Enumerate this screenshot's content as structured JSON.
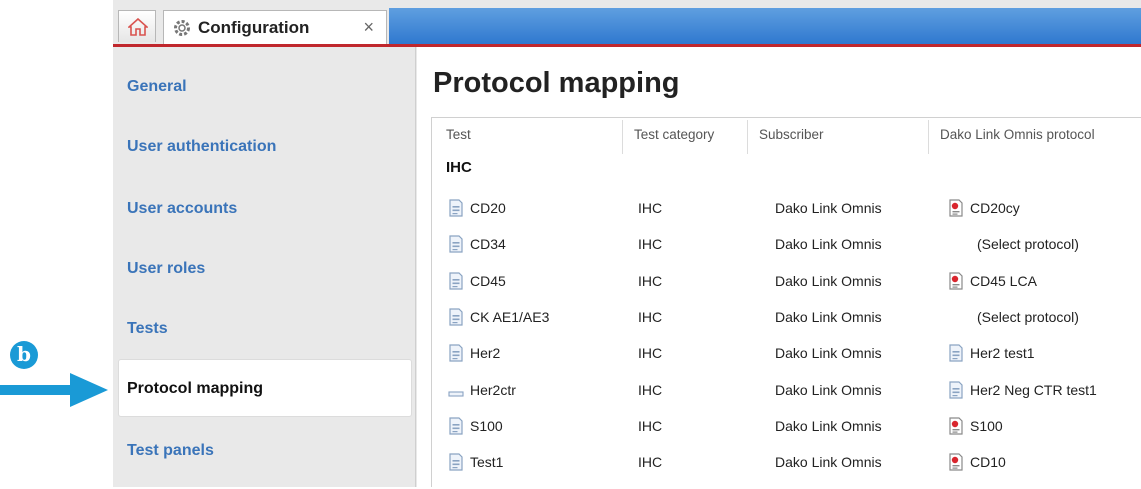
{
  "callout": {
    "label": "b"
  },
  "tab": {
    "title": "Configuration",
    "close": "×"
  },
  "sidebar": {
    "items": [
      {
        "label": "General"
      },
      {
        "label": "User authentication"
      },
      {
        "label": "User accounts"
      },
      {
        "label": "User roles"
      },
      {
        "label": "Tests"
      },
      {
        "label": "Protocol mapping",
        "selected": true
      },
      {
        "label": "Test panels"
      }
    ]
  },
  "main": {
    "title": "Protocol mapping",
    "columns": [
      "Test",
      "Test category",
      "Subscriber",
      "Dako Link Omnis protocol"
    ],
    "group": "IHC",
    "rows": [
      {
        "test": "CD20",
        "category": "IHC",
        "subscriber": "Dako Link Omnis",
        "protocol": "CD20cy",
        "test_icon": "doc-icon",
        "protocol_icon": "red-doc-icon"
      },
      {
        "test": "CD34",
        "category": "IHC",
        "subscriber": "Dako Link Omnis",
        "protocol": "(Select protocol)",
        "test_icon": "doc-icon",
        "protocol_icon": ""
      },
      {
        "test": "CD45",
        "category": "IHC",
        "subscriber": "Dako Link Omnis",
        "protocol": "CD45 LCA",
        "test_icon": "doc-icon",
        "protocol_icon": "red-doc-icon"
      },
      {
        "test": "CK AE1/AE3",
        "category": "IHC",
        "subscriber": "Dako Link Omnis",
        "protocol": "(Select protocol)",
        "test_icon": "doc-icon",
        "protocol_icon": ""
      },
      {
        "test": "Her2",
        "category": "IHC",
        "subscriber": "Dako Link Omnis",
        "protocol": "Her2 test1",
        "test_icon": "doc-icon",
        "protocol_icon": "doc-icon"
      },
      {
        "test": "Her2ctr",
        "category": "IHC",
        "subscriber": "Dako Link Omnis",
        "protocol": "Her2 Neg CTR test1",
        "test_icon": "control-icon",
        "protocol_icon": "doc-icon"
      },
      {
        "test": "S100",
        "category": "IHC",
        "subscriber": "Dako Link Omnis",
        "protocol": "S100",
        "test_icon": "doc-icon",
        "protocol_icon": "red-doc-icon"
      },
      {
        "test": "Test1",
        "category": "IHC",
        "subscriber": "Dako Link Omnis",
        "protocol": "CD10",
        "test_icon": "doc-icon",
        "protocol_icon": "red-doc-icon"
      }
    ]
  }
}
